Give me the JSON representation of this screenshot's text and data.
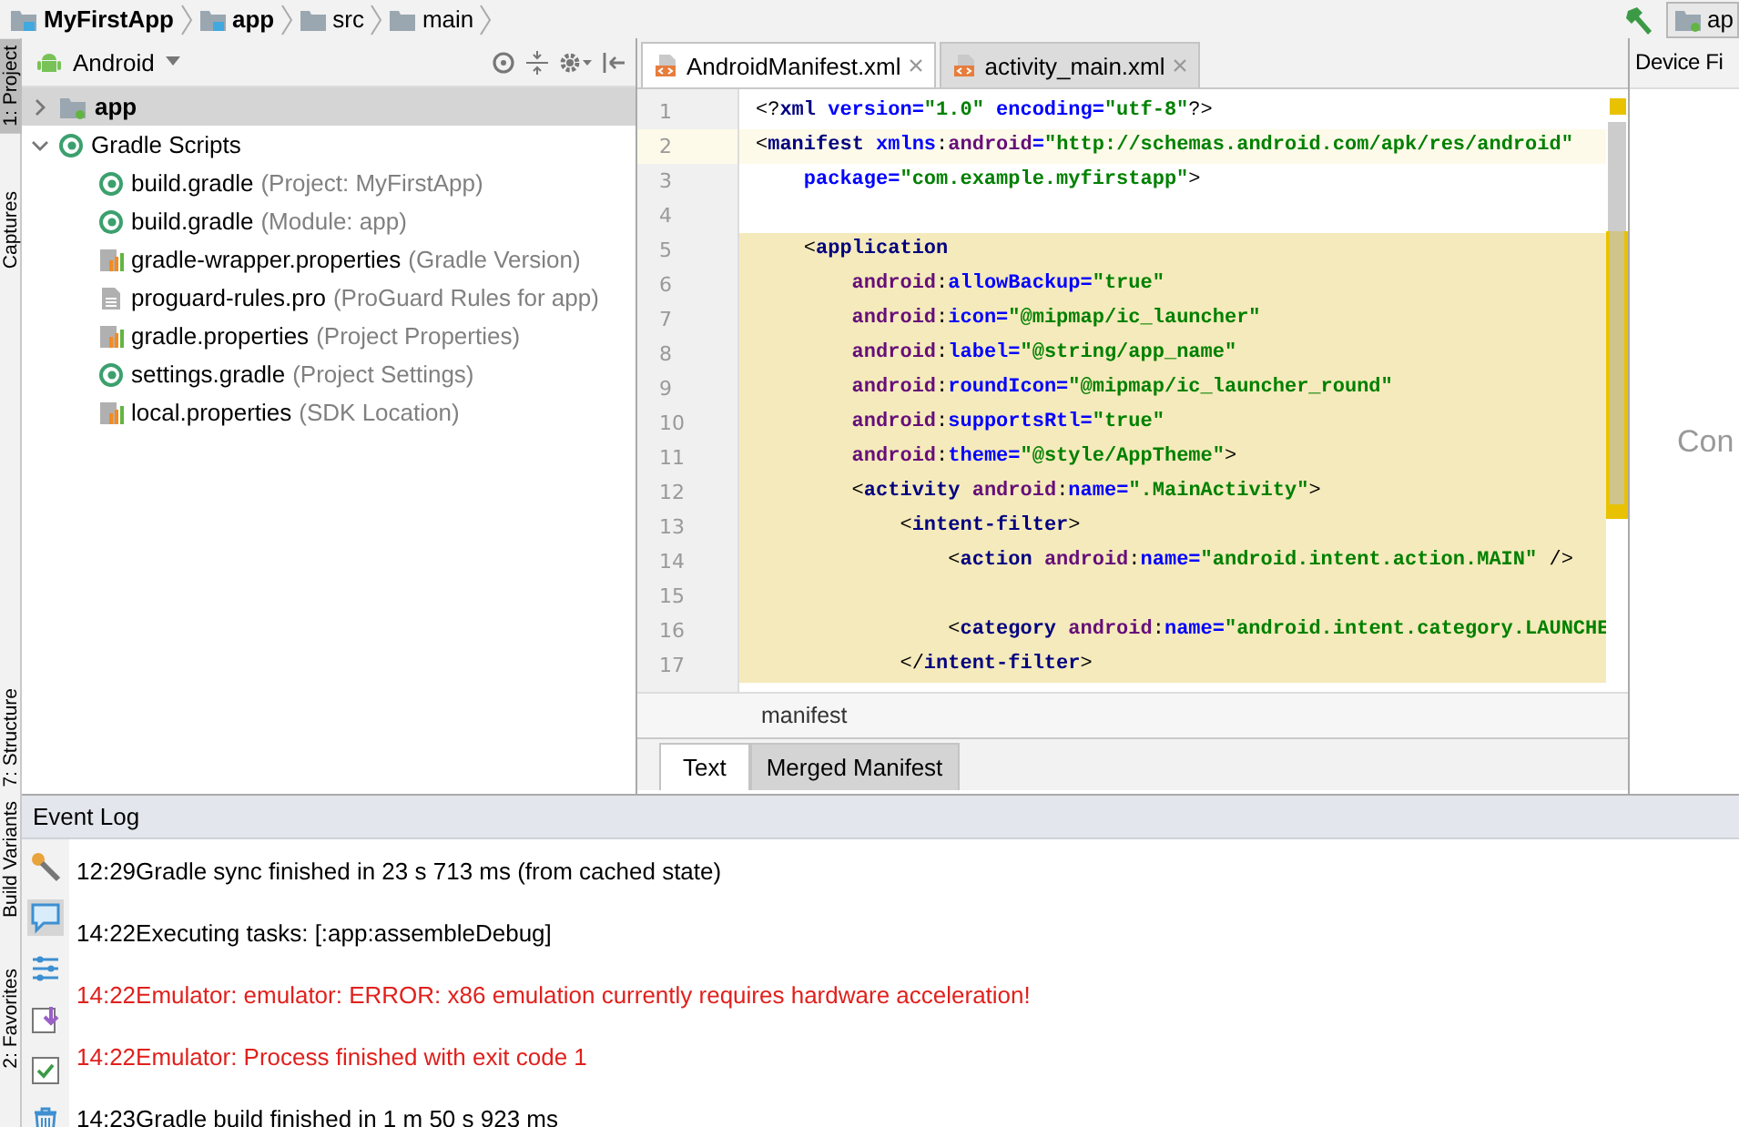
{
  "breadcrumbs": [
    {
      "label": "MyFirstApp",
      "kind": "module"
    },
    {
      "label": "app",
      "kind": "module"
    },
    {
      "label": "src",
      "kind": "folder"
    },
    {
      "label": "main",
      "kind": "folder"
    }
  ],
  "run_config": {
    "label": "ap"
  },
  "tool_strip": [
    {
      "label": "1: Project",
      "selected": true
    },
    {
      "label": "Captures",
      "selected": false
    },
    {
      "label": "7: Structure",
      "selected": false
    },
    {
      "label": "Build Variants",
      "selected": false
    },
    {
      "label": "2: Favorites",
      "selected": false
    }
  ],
  "project": {
    "view": "Android",
    "tree": [
      {
        "label": "app",
        "kind": "module",
        "selected": true,
        "expanded": false
      },
      {
        "label": "Gradle Scripts",
        "kind": "gradle",
        "selected": false,
        "expanded": true,
        "children": [
          {
            "label": "build.gradle",
            "hint": "(Project: MyFirstApp)",
            "kind": "gradle"
          },
          {
            "label": "build.gradle",
            "hint": "(Module: app)",
            "kind": "gradle"
          },
          {
            "label": "gradle-wrapper.properties",
            "hint": "(Gradle Version)",
            "kind": "properties"
          },
          {
            "label": "proguard-rules.pro",
            "hint": "(ProGuard Rules for app)",
            "kind": "text"
          },
          {
            "label": "gradle.properties",
            "hint": "(Project Properties)",
            "kind": "properties"
          },
          {
            "label": "settings.gradle",
            "hint": "(Project Settings)",
            "kind": "gradle"
          },
          {
            "label": "local.properties",
            "hint": "(SDK Location)",
            "kind": "properties"
          }
        ]
      }
    ]
  },
  "editor": {
    "tabs": [
      {
        "label": "AndroidManifest.xml",
        "selected": true
      },
      {
        "label": "activity_main.xml",
        "selected": false
      }
    ],
    "lines": [
      {
        "number": "1",
        "current": false,
        "in_scope": false,
        "tokens": [
          {
            "t": "<?",
            "kind": "punct"
          },
          {
            "t": "xml ",
            "kind": "tag"
          },
          {
            "t": "version=",
            "kind": "attr"
          },
          {
            "t": "\"1.0\" ",
            "kind": "value"
          },
          {
            "t": "encoding=",
            "kind": "attr"
          },
          {
            "t": "\"utf-8\"",
            "kind": "value"
          },
          {
            "t": "?>",
            "kind": "punct"
          }
        ]
      },
      {
        "number": "2",
        "current": true,
        "in_scope": false,
        "tokens": [
          {
            "t": "<",
            "kind": "punct"
          },
          {
            "t": "manifest ",
            "kind": "tag"
          },
          {
            "t": "xmlns",
            "kind": "attr"
          },
          {
            "t": ":",
            "kind": "punct"
          },
          {
            "t": "android",
            "kind": "ns"
          },
          {
            "t": "=",
            "kind": "attr"
          },
          {
            "t": "\"http://schemas.android.com/apk/res/android\"",
            "kind": "value"
          }
        ]
      },
      {
        "number": "3",
        "current": false,
        "in_scope": false,
        "tokens": [
          {
            "t": "    package=",
            "kind": "attr"
          },
          {
            "t": "\"com.example.myfirstapp\"",
            "kind": "value"
          },
          {
            "t": ">",
            "kind": "punct"
          }
        ]
      },
      {
        "number": "4",
        "current": false,
        "in_scope": false
      },
      {
        "number": "5",
        "current": false,
        "in_scope": true,
        "tokens": [
          {
            "t": "    <",
            "kind": "punct"
          },
          {
            "t": "application",
            "kind": "tag"
          }
        ]
      },
      {
        "number": "6",
        "current": false,
        "in_scope": true,
        "tokens": [
          {
            "t": "        android",
            "kind": "ns"
          },
          {
            "t": ":",
            "kind": "punct"
          },
          {
            "t": "allowBackup=",
            "kind": "attr"
          },
          {
            "t": "\"true\"",
            "kind": "value"
          }
        ]
      },
      {
        "number": "7",
        "current": false,
        "in_scope": true,
        "tokens": [
          {
            "t": "        android",
            "kind": "ns"
          },
          {
            "t": ":",
            "kind": "punct"
          },
          {
            "t": "icon=",
            "kind": "attr"
          },
          {
            "t": "\"@mipmap/ic_launcher\"",
            "kind": "value"
          }
        ]
      },
      {
        "number": "8",
        "current": false,
        "in_scope": true,
        "tokens": [
          {
            "t": "        android",
            "kind": "ns"
          },
          {
            "t": ":",
            "kind": "punct"
          },
          {
            "t": "label=",
            "kind": "attr"
          },
          {
            "t": "\"@string/app_name\"",
            "kind": "value"
          }
        ]
      },
      {
        "number": "9",
        "current": false,
        "in_scope": true,
        "tokens": [
          {
            "t": "        android",
            "kind": "ns"
          },
          {
            "t": ":",
            "kind": "punct"
          },
          {
            "t": "roundIcon=",
            "kind": "attr"
          },
          {
            "t": "\"@mipmap/ic_launcher_round\"",
            "kind": "value"
          }
        ]
      },
      {
        "number": "10",
        "current": false,
        "in_scope": true,
        "tokens": [
          {
            "t": "        android",
            "kind": "ns"
          },
          {
            "t": ":",
            "kind": "punct"
          },
          {
            "t": "supportsRtl=",
            "kind": "attr"
          },
          {
            "t": "\"true\"",
            "kind": "value"
          }
        ]
      },
      {
        "number": "11",
        "current": false,
        "in_scope": true,
        "tokens": [
          {
            "t": "        android",
            "kind": "ns"
          },
          {
            "t": ":",
            "kind": "punct"
          },
          {
            "t": "theme=",
            "kind": "attr"
          },
          {
            "t": "\"@style/AppTheme\"",
            "kind": "value"
          },
          {
            "t": ">",
            "kind": "punct"
          }
        ]
      },
      {
        "number": "12",
        "current": false,
        "in_scope": true,
        "tokens": [
          {
            "t": "        <",
            "kind": "punct"
          },
          {
            "t": "activity ",
            "kind": "tag"
          },
          {
            "t": "android",
            "kind": "ns"
          },
          {
            "t": ":",
            "kind": "punct"
          },
          {
            "t": "name=",
            "kind": "attr"
          },
          {
            "t": "\".MainActivity\"",
            "kind": "value"
          },
          {
            "t": ">",
            "kind": "punct"
          }
        ]
      },
      {
        "number": "13",
        "current": false,
        "in_scope": true,
        "tokens": [
          {
            "t": "            <",
            "kind": "punct"
          },
          {
            "t": "intent-filter",
            "kind": "tag"
          },
          {
            "t": ">",
            "kind": "punct"
          }
        ]
      },
      {
        "number": "14",
        "current": false,
        "in_scope": true,
        "tokens": [
          {
            "t": "                <",
            "kind": "punct"
          },
          {
            "t": "action ",
            "kind": "tag"
          },
          {
            "t": "android",
            "kind": "ns"
          },
          {
            "t": ":",
            "kind": "punct"
          },
          {
            "t": "name=",
            "kind": "attr"
          },
          {
            "t": "\"android.intent.action.MAIN\" ",
            "kind": "value"
          },
          {
            "t": "/>",
            "kind": "punct"
          }
        ]
      },
      {
        "number": "15",
        "current": false,
        "in_scope": true
      },
      {
        "number": "16",
        "current": false,
        "in_scope": true,
        "tokens": [
          {
            "t": "                <",
            "kind": "punct"
          },
          {
            "t": "category ",
            "kind": "tag"
          },
          {
            "t": "android",
            "kind": "ns"
          },
          {
            "t": ":",
            "kind": "punct"
          },
          {
            "t": "name=",
            "kind": "attr"
          },
          {
            "t": "\"android.intent.category.LAUNCHE",
            "kind": "value"
          }
        ]
      },
      {
        "number": "17",
        "current": false,
        "in_scope": true,
        "tokens": [
          {
            "t": "            </",
            "kind": "punct"
          },
          {
            "t": "intent-filter",
            "kind": "tag"
          },
          {
            "t": ">",
            "kind": "punct"
          }
        ]
      }
    ],
    "breadcrumb": "manifest",
    "bottom_tabs": [
      {
        "label": "Text",
        "selected": true
      },
      {
        "label": "Merged Manifest",
        "selected": false
      }
    ]
  },
  "device_panel": {
    "title": "Device Fi",
    "message": "Con"
  },
  "event_log": {
    "title": "Event Log",
    "entries": [
      {
        "time": "12:29",
        "message": "Gradle sync finished in 23 s 713 ms (from cached state)",
        "kind": "info"
      },
      {
        "time": "14:22",
        "message": "Executing tasks: [:app:assembleDebug]",
        "kind": "info"
      },
      {
        "time": "14:22",
        "message": "Emulator: emulator: ERROR: x86 emulation currently requires hardware acceleration!",
        "kind": "error"
      },
      {
        "time": "14:22",
        "message": "Emulator: Process finished with exit code 1",
        "kind": "error"
      },
      {
        "time": "14:23",
        "message": "Gradle build finished in 1 m 50 s 923 ms",
        "kind": "info"
      }
    ]
  }
}
